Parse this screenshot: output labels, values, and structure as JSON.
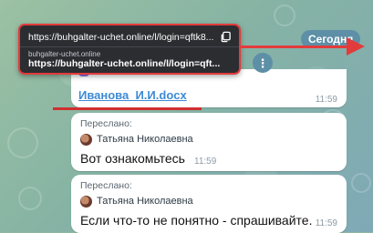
{
  "url_popup": {
    "url_line": "https://buhgalter-uchet.online/l/login=qftk8...",
    "host": "buhgalter-uchet.online",
    "url_bold": "https://buhgalter-uchet.online/l/login=qft..."
  },
  "date_chip": "Сегодня",
  "file_message": {
    "file_name": "Иванова_И.И.docx",
    "time": "11:59"
  },
  "messages": [
    {
      "forwarded_label": "Переслано:",
      "sender": "Татьяна Николаевна",
      "text": "Вот ознакомьтесь",
      "time": "11:59"
    },
    {
      "forwarded_label": "Переслано:",
      "sender": "Татьяна Николаевна",
      "text": "Если что-то не понятно - спрашивайте.",
      "time": "11:59"
    }
  ],
  "icons": {
    "copy": "copy-icon",
    "more": "more-vertical-icon",
    "file": "file-icon",
    "avatar": "avatar"
  },
  "colors": {
    "popup_bg": "#2b2d31",
    "highlight_red": "#e23b3b",
    "link_blue": "#3d8bd6",
    "date_chip_bg": "#5d8fa6"
  }
}
